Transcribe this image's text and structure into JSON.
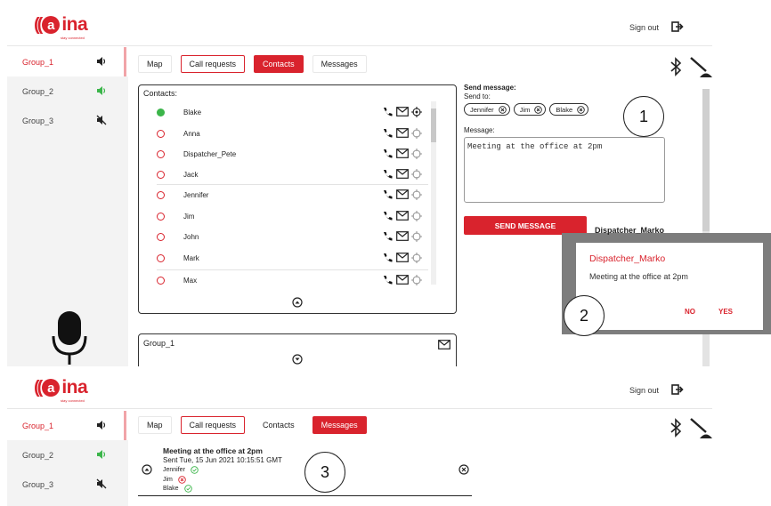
{
  "app": {
    "logo_text": "aina",
    "logo_letter": "a",
    "logo_tagline": "stay connected",
    "sign_out": "Sign out"
  },
  "colors": {
    "brand": "#d9232d",
    "online": "#3bb54a"
  },
  "sidebar": {
    "items": [
      {
        "label": "Group_1",
        "speaker": "volume-icon",
        "active": true
      },
      {
        "label": "Group_2",
        "speaker": "volume-green-icon",
        "active": false
      },
      {
        "label": "Group_3",
        "speaker": "volume-muted-icon",
        "active": false
      }
    ]
  },
  "tabs": {
    "map": "Map",
    "call_requests": "Call requests",
    "contacts": "Contacts",
    "messages": "Messages"
  },
  "contacts": {
    "title": "Contacts:",
    "items": [
      {
        "name": "Blake",
        "online": true
      },
      {
        "name": "Anna",
        "online": false
      },
      {
        "name": "Dispatcher_Pete",
        "online": false
      },
      {
        "name": "Jack",
        "online": false
      },
      {
        "name": "Jennifer",
        "online": false
      },
      {
        "name": "Jim",
        "online": false
      },
      {
        "name": "John",
        "online": false
      },
      {
        "name": "Mark",
        "online": false
      },
      {
        "name": "Max",
        "online": false
      }
    ]
  },
  "group_box": {
    "title": "Group_1"
  },
  "send": {
    "title": "Send message:",
    "to_label": "Send to:",
    "recipients": [
      "Jennifer",
      "Jim",
      "Blake"
    ],
    "message_label": "Message:",
    "message_value": "Meeting at the office at 2pm",
    "button": "SEND MESSAGE"
  },
  "dialog": {
    "behind_text": "Dispatcher_Marko",
    "title": "Dispatcher_Marko",
    "text": "Meeting at the office at 2pm",
    "no": "NO",
    "yes": "YES"
  },
  "callouts": {
    "one": "1",
    "two": "2",
    "three": "3"
  },
  "message_entry": {
    "title": "Meeting at the office at 2pm",
    "sent": "Sent Tue, 15 Jun 2021 10:15:51 GMT",
    "recipients": [
      {
        "name": "Jennifer",
        "status": "delivered"
      },
      {
        "name": "Jim",
        "status": "failed"
      },
      {
        "name": "Blake",
        "status": "delivered"
      }
    ]
  }
}
